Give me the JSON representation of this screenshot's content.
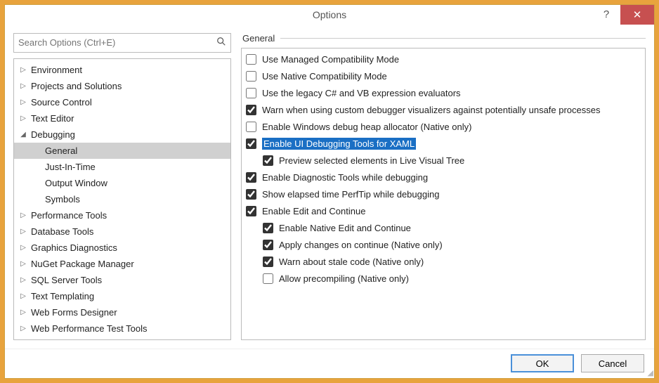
{
  "titlebar": {
    "title": "Options",
    "help": "?",
    "close": "✕"
  },
  "search": {
    "placeholder": "Search Options (Ctrl+E)"
  },
  "tree": [
    {
      "label": "Environment",
      "expanded": false,
      "depth": 0
    },
    {
      "label": "Projects and Solutions",
      "expanded": false,
      "depth": 0
    },
    {
      "label": "Source Control",
      "expanded": false,
      "depth": 0
    },
    {
      "label": "Text Editor",
      "expanded": false,
      "depth": 0
    },
    {
      "label": "Debugging",
      "expanded": true,
      "depth": 0
    },
    {
      "label": "General",
      "depth": 1,
      "selected": true
    },
    {
      "label": "Just-In-Time",
      "depth": 1
    },
    {
      "label": "Output Window",
      "depth": 1
    },
    {
      "label": "Symbols",
      "depth": 1
    },
    {
      "label": "Performance Tools",
      "expanded": false,
      "depth": 0
    },
    {
      "label": "Database Tools",
      "expanded": false,
      "depth": 0
    },
    {
      "label": "Graphics Diagnostics",
      "expanded": false,
      "depth": 0
    },
    {
      "label": "NuGet Package Manager",
      "expanded": false,
      "depth": 0
    },
    {
      "label": "SQL Server Tools",
      "expanded": false,
      "depth": 0
    },
    {
      "label": "Text Templating",
      "expanded": false,
      "depth": 0
    },
    {
      "label": "Web Forms Designer",
      "expanded": false,
      "depth": 0
    },
    {
      "label": "Web Performance Test Tools",
      "expanded": false,
      "depth": 0
    }
  ],
  "section": {
    "title": "General"
  },
  "options": [
    {
      "label": "Use Managed Compatibility Mode",
      "checked": false,
      "indent": 0
    },
    {
      "label": "Use Native Compatibility Mode",
      "checked": false,
      "indent": 0
    },
    {
      "label": "Use the legacy C# and VB expression evaluators",
      "checked": false,
      "indent": 0
    },
    {
      "label": "Warn when using custom debugger visualizers against potentially unsafe processes",
      "checked": true,
      "indent": 0
    },
    {
      "label": "Enable Windows debug heap allocator (Native only)",
      "checked": false,
      "indent": 0
    },
    {
      "label": "Enable UI Debugging Tools for XAML",
      "checked": true,
      "indent": 0,
      "highlighted": true
    },
    {
      "label": "Preview selected elements in Live Visual Tree",
      "checked": true,
      "indent": 1
    },
    {
      "label": "Enable Diagnostic Tools while debugging",
      "checked": true,
      "indent": 0
    },
    {
      "label": "Show elapsed time PerfTip while debugging",
      "checked": true,
      "indent": 0
    },
    {
      "label": "Enable Edit and Continue",
      "checked": true,
      "indent": 0
    },
    {
      "label": "Enable Native Edit and Continue",
      "checked": true,
      "indent": 1
    },
    {
      "label": "Apply changes on continue (Native only)",
      "checked": true,
      "indent": 1
    },
    {
      "label": "Warn about stale code (Native only)",
      "checked": true,
      "indent": 1
    },
    {
      "label": "Allow precompiling (Native only)",
      "checked": false,
      "indent": 1
    }
  ],
  "footer": {
    "ok": "OK",
    "cancel": "Cancel"
  }
}
